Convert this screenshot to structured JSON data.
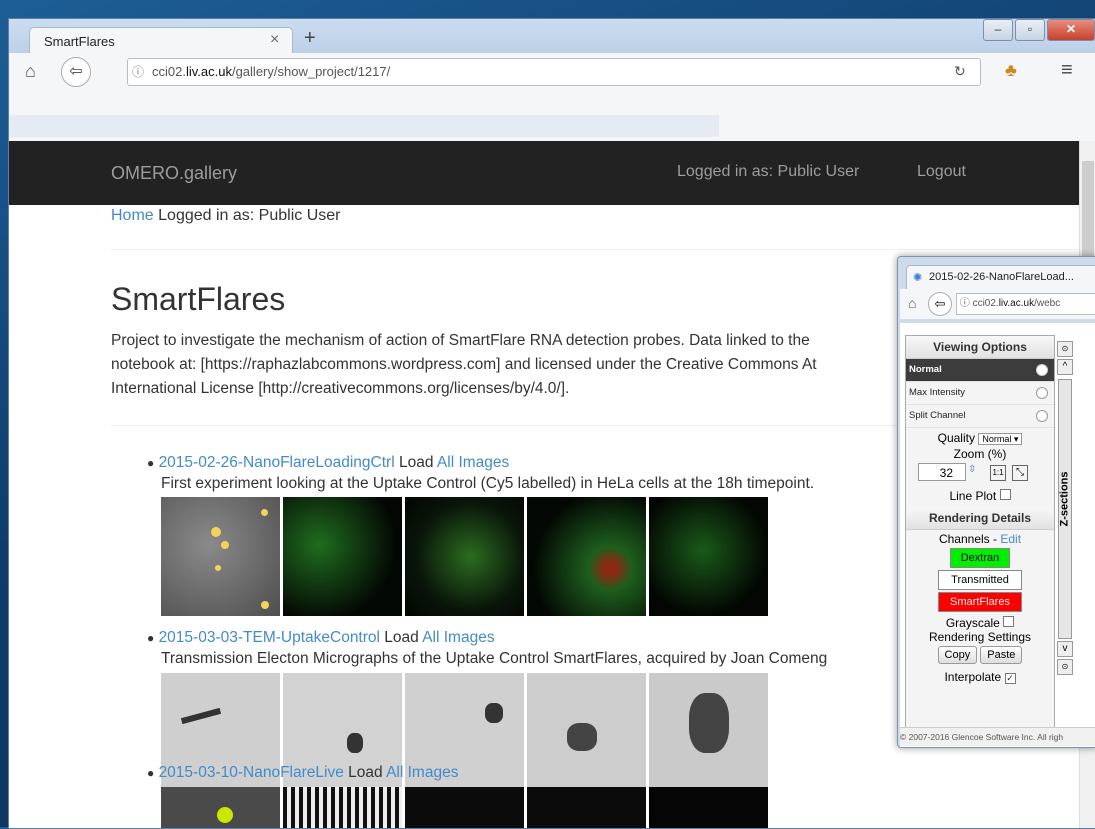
{
  "browser": {
    "tab_title": "SmartFlares",
    "url_prefix": "cci02.",
    "url_domain": "liv.ac.uk",
    "url_path": "/gallery/show_project/1217/"
  },
  "site": {
    "brand": "OMERO.gallery",
    "nav_logged_in": "Logged in as: Public User",
    "nav_logout": "Logout",
    "breadcrumb_home": "Home",
    "breadcrumb_user": "Logged in as: Public User"
  },
  "project": {
    "title": "SmartFlares",
    "description_1": "Project to investigate the mechanism of action of SmartFlare RNA detection probes. Data linked to the",
    "description_2": "notebook at: [https://raphazlabcommons.wordpress.com] and licensed under the Creative Commons At",
    "description_3": "International License [http://creativecommons.org/licenses/by/4.0/]."
  },
  "datasets": [
    {
      "name": "2015-02-26-NanoFlareLoadingCtrl",
      "load": "Load",
      "all": "All Images",
      "desc": "First experiment looking at the Uptake Control (Cy5 labelled) in HeLa cells at the 18h timepoint."
    },
    {
      "name": "2015-03-03-TEM-UptakeControl",
      "load": "Load",
      "all": "All Images",
      "desc": "Transmission Electon Micrographs of the Uptake Control SmartFlares, acquired by Joan Comeng"
    },
    {
      "name": "2015-03-10-NanoFlareLive",
      "load": "Load",
      "all": "All Images",
      "desc": ""
    }
  ],
  "popup": {
    "tab_title": "2015-02-26-NanoFlareLoad...",
    "url_prefix": "cci02.",
    "url_domain": "liv.ac.uk",
    "url_path": "/webc",
    "viewing_options": "Viewing Options",
    "opt_normal": "Normal",
    "opt_max": "Max Intensity",
    "opt_split": "Split Channel",
    "quality_label": "Quality",
    "quality_value": "Normal",
    "zoom_label": "Zoom (%)",
    "zoom_value": "32",
    "line_plot": "Line Plot",
    "rendering_details": "Rendering Details",
    "channels_label": "Channels -",
    "channels_edit": "Edit",
    "channels": [
      {
        "name": "Dextran",
        "color": "#00ee00"
      },
      {
        "name": "Transmitted",
        "color": "#ffffff"
      },
      {
        "name": "SmartFlares",
        "color": "#ff0000"
      }
    ],
    "grayscale": "Grayscale",
    "rendering_settings": "Rendering Settings",
    "copy": "Copy",
    "paste": "Paste",
    "interpolate": "Interpolate",
    "z_sections": "Z-sections",
    "footer": "© 2007-2016 Glencoe Software Inc. All righ"
  }
}
